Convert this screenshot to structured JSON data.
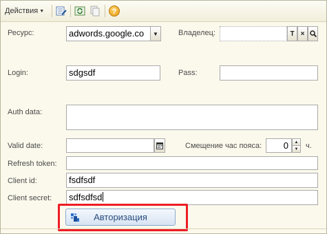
{
  "toolbar": {
    "actions_label": "Действия",
    "icons": [
      "edit-list-icon",
      "refresh-icon",
      "copy-icon",
      "help-icon"
    ],
    "help_glyph": "?"
  },
  "form": {
    "resource": {
      "label": "Ресурс:",
      "value": "adwords.google.co"
    },
    "owner": {
      "label": "Владелец:",
      "value": "",
      "btn_t": "T",
      "btn_x": "×"
    },
    "login": {
      "label": "Login:",
      "value": "sdgsdf"
    },
    "pass": {
      "label": "Pass:",
      "value": ""
    },
    "auth_data": {
      "label": "Auth data:",
      "value": ""
    },
    "valid_date": {
      "label": "Valid date:",
      "value": "  .  .        :  :"
    },
    "tz_offset": {
      "label": "Смещение час пояса:",
      "value": "0",
      "unit": "ч."
    },
    "refresh_token": {
      "label": "Refresh token:",
      "value": ""
    },
    "client_id": {
      "label": "Client id:",
      "value": "fsdfsdf"
    },
    "client_secret": {
      "label": "Client secret:",
      "value": "sdfsdfsd"
    }
  },
  "auth_button": {
    "label": "Авторизация"
  },
  "colors": {
    "highlight": "#ee1c24",
    "accent_text": "#2a4d7d"
  }
}
